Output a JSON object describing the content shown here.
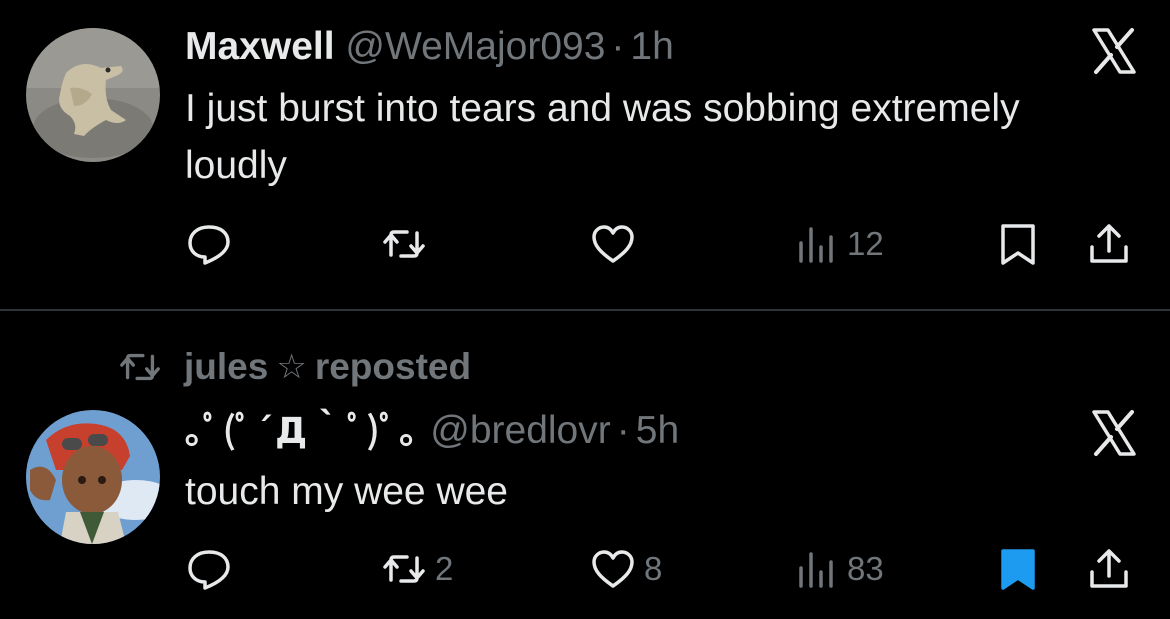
{
  "tweets": [
    {
      "display_name": "Maxwell",
      "handle": "@WeMajor093",
      "separator": "·",
      "time": "1h",
      "text": "I just burst into tears and was sobbing extremely loudly",
      "avatar_icon": "lizard-figurine-avatar",
      "actions": {
        "reply_count": "",
        "repost_count": "",
        "like_count": "",
        "views_count": "12",
        "bookmarked": false
      }
    },
    {
      "repost_by": "jules",
      "repost_star": "☆",
      "repost_suffix": "reposted",
      "display_name": "｡ﾟ(ﾟ´Д｀ﾟ)ﾟ｡",
      "handle": "@bredlovr",
      "separator": "·",
      "time": "5h",
      "text": "touch my wee wee",
      "avatar_icon": "anime-character-avatar",
      "actions": {
        "reply_count": "",
        "repost_count": "2",
        "like_count": "8",
        "views_count": "83",
        "bookmarked": true
      }
    }
  ],
  "colors": {
    "background": "#000000",
    "primary_text": "#e7e9ea",
    "secondary_text": "#71767b",
    "divider": "#2f3336",
    "bookmark_active": "#1d9bf0"
  }
}
